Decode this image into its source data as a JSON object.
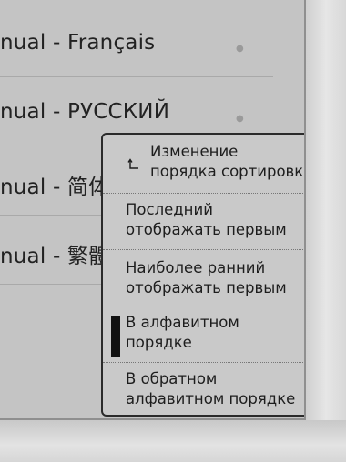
{
  "book_list": {
    "items": [
      {
        "title": "nual - Français"
      },
      {
        "title": "nual - РУССКИЙ"
      },
      {
        "title": "nual - 简体"
      },
      {
        "title": "nual - 繁體"
      }
    ]
  },
  "sort_menu": {
    "header_label": "Изменение\nпорядка сортировки",
    "options": [
      {
        "label": "Последний\nотображать первым",
        "selected": false
      },
      {
        "label": "Наиболее ранний\nотображать первым",
        "selected": false
      },
      {
        "label": "В алфавитном\nпорядке",
        "selected": true
      },
      {
        "label": "В обратном\nалфавитном порядке",
        "selected": false
      }
    ]
  },
  "icons": {
    "back": "return-arrow-icon",
    "selection": "selected-marker"
  },
  "colors": {
    "screen_bg": "#c4c4c4",
    "text": "#1d1d1d",
    "menu_border": "#2a2a2a",
    "selection_marker": "#111111"
  }
}
